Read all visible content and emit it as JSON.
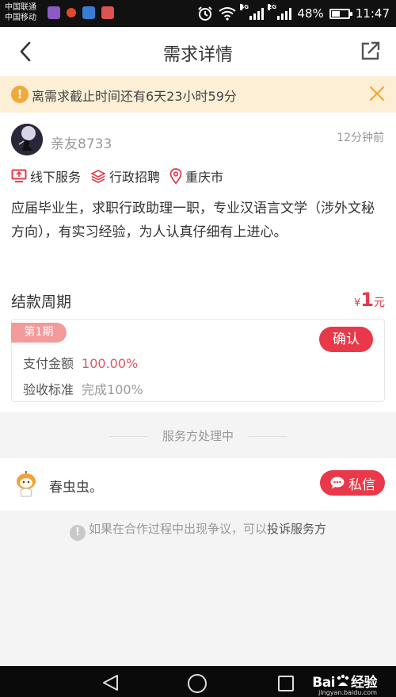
{
  "status_bar": {
    "carrier_1": "中国联通",
    "carrier_2": "中国移动",
    "network_1": "4G",
    "network_2": "2G",
    "battery": "48%",
    "battery_level": 0.48,
    "time": "11:47"
  },
  "header": {
    "title": "需求详情"
  },
  "notice": {
    "text": "离需求截止时间还有6天23小时59分",
    "icon_glyph": "!"
  },
  "post": {
    "username": "亲友8733",
    "time_ago": "12分钟前",
    "tags": [
      "线下服务",
      "行政招聘",
      "重庆市"
    ],
    "description": "应届毕业生，求职行政助理一职，专业汉语言文学（涉外文秘方向），有实习经验，为人认真仔细有上进心。"
  },
  "payment": {
    "section_title": "结款周期",
    "currency": "¥",
    "amount": "1",
    "unit": "元",
    "period_badge": "第1期",
    "confirm_label": "确认",
    "pay_amount_label": "支付金额",
    "pay_amount_value": "100.00%",
    "acceptance_label": "验收标准",
    "acceptance_value": "完成100%"
  },
  "status": {
    "text": "服务方处理中"
  },
  "provider": {
    "name": "春虫虫。",
    "message_label": "私信"
  },
  "dispute": {
    "text": "如果在合作过程中出现争议，可以",
    "link": "投诉服务方"
  },
  "watermark": {
    "main": "Bai",
    "main_2": "经验",
    "sub": "jingyan.baidu.com"
  },
  "colors": {
    "accent": "#e8384a",
    "notice_bg": "#fcefd5",
    "notice_icon": "#f0a93a",
    "badge": "#f39a9a"
  }
}
